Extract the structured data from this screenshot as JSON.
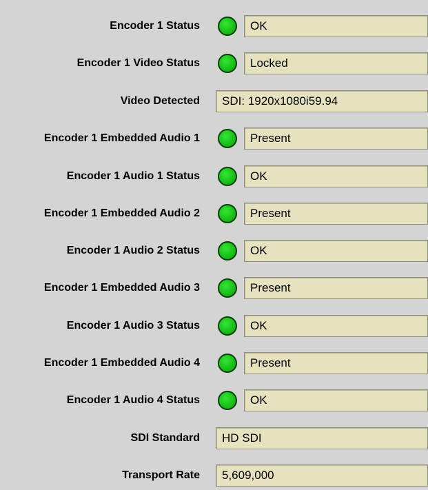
{
  "rows": [
    {
      "label": "Encoder 1 Status",
      "value": "OK",
      "indicator": "green"
    },
    {
      "label": "Encoder 1 Video Status",
      "value": "Locked",
      "indicator": "green"
    },
    {
      "label": "Video Detected",
      "value": "SDI: 1920x1080i59.94"
    },
    {
      "label": "Encoder 1 Embedded Audio 1",
      "value": "Present",
      "indicator": "green"
    },
    {
      "label": "Encoder 1 Audio 1 Status",
      "value": "OK",
      "indicator": "green"
    },
    {
      "label": "Encoder 1 Embedded Audio 2",
      "value": "Present",
      "indicator": "green"
    },
    {
      "label": "Encoder 1 Audio 2 Status",
      "value": "OK",
      "indicator": "green"
    },
    {
      "label": "Encoder 1 Embedded Audio 3",
      "value": "Present",
      "indicator": "green"
    },
    {
      "label": "Encoder 1 Audio 3 Status",
      "value": "OK",
      "indicator": "green"
    },
    {
      "label": "Encoder 1 Embedded Audio 4",
      "value": "Present",
      "indicator": "green"
    },
    {
      "label": "Encoder 1 Audio 4 Status",
      "value": "OK",
      "indicator": "green"
    },
    {
      "label": "SDI Standard",
      "value": "HD SDI"
    },
    {
      "label": "Transport Rate",
      "value": "5,609,000"
    }
  ],
  "colors": {
    "background": "#d4d4d4",
    "field_background": "#e6e2c0",
    "indicator_green": "#19c119"
  }
}
